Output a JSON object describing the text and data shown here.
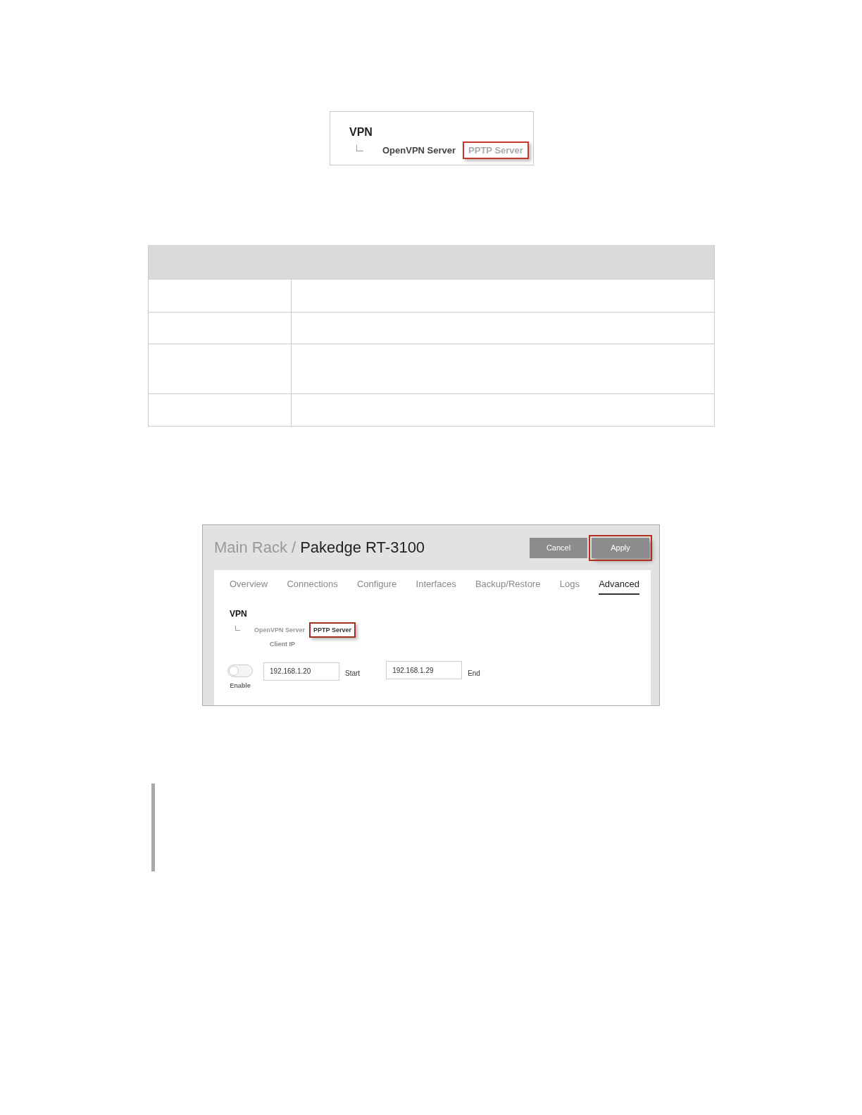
{
  "vpn_snippet": {
    "heading": "VPN",
    "items": [
      {
        "label": "OpenVPN Server",
        "dimmed": false,
        "highlighted": false
      },
      {
        "label": "PPTP Server",
        "dimmed": true,
        "highlighted": true
      }
    ]
  },
  "router_screen": {
    "breadcrumb_parent": "Main Rack /",
    "title": "Pakedge RT-3100",
    "buttons": [
      {
        "label": "Cancel",
        "highlighted": false
      },
      {
        "label": "Apply",
        "highlighted": true
      }
    ],
    "tabs": [
      {
        "label": "Overview",
        "selected": false
      },
      {
        "label": "Connections",
        "selected": false
      },
      {
        "label": "Configure",
        "selected": false
      },
      {
        "label": "Interfaces",
        "selected": false
      },
      {
        "label": "Backup/Restore",
        "selected": false
      },
      {
        "label": "Logs",
        "selected": false
      },
      {
        "label": "Advanced",
        "selected": true
      }
    ],
    "vpn_heading": "VPN",
    "vpn_items": [
      {
        "label": "OpenVPN Server",
        "dimmed": true,
        "highlighted": false
      },
      {
        "label": "PPTP Server",
        "dimmed": false,
        "highlighted": true
      }
    ],
    "client_ip_label": "Client IP",
    "enable": {
      "label": "Enable",
      "on": false
    },
    "start": {
      "value": "192.168.1.20",
      "label": "Start"
    },
    "end": {
      "value": "192.168.1.29",
      "label": "End"
    }
  }
}
